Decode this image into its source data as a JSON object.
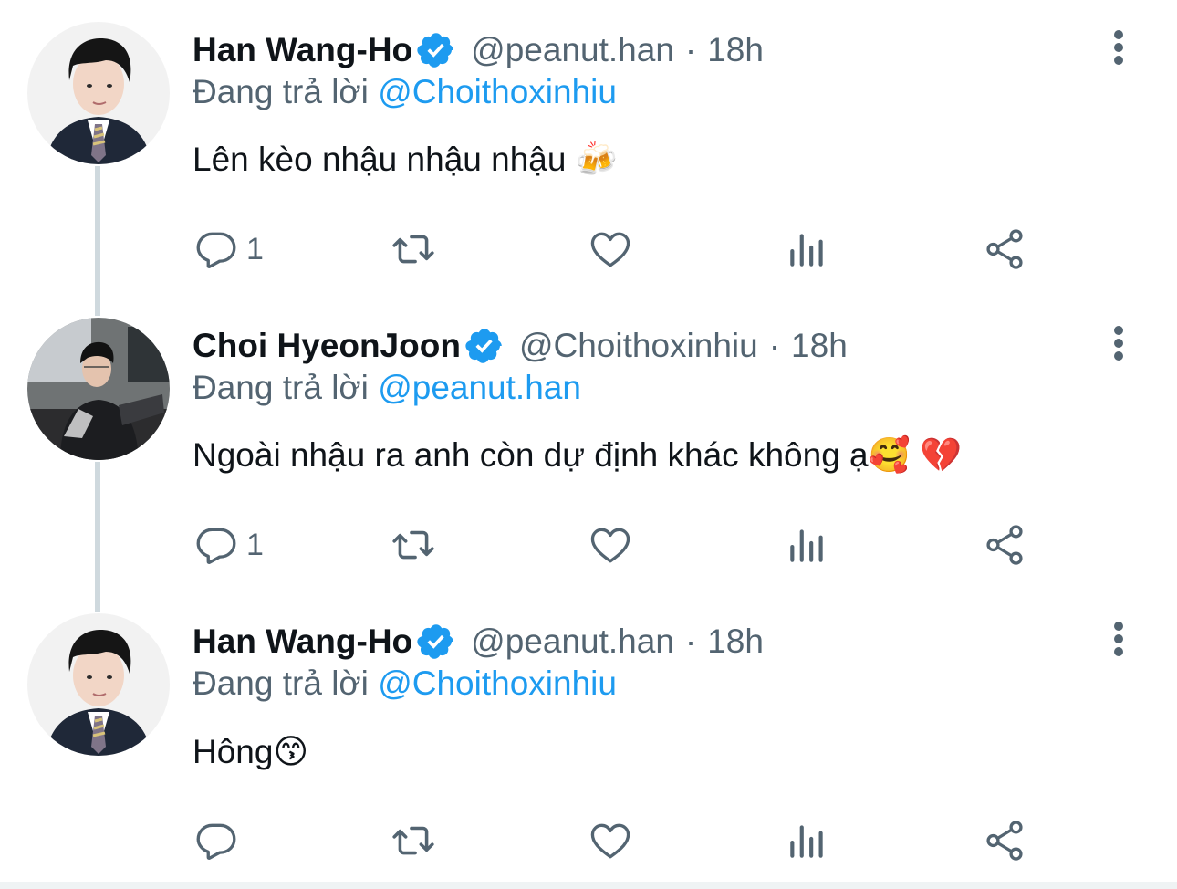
{
  "colors": {
    "accent": "#1d9bf0",
    "text": "#0f1419",
    "secondary": "#536471",
    "thread_line": "#cfd9de"
  },
  "tweets": [
    {
      "name": "Han Wang-Ho",
      "handle": "@peanut.han",
      "separator": "·",
      "time": "18h",
      "replying_prefix": "Đang trả lời",
      "replying_to": "@Choithoxinhiu",
      "text": "Lên kèo nhậu nhậu nhậu 🍻",
      "reply_count": "1",
      "avatar_icon": "avatar-photo"
    },
    {
      "name": "Choi HyeonJoon",
      "handle": "@Choithoxinhiu",
      "separator": "·",
      "time": "18h",
      "replying_prefix": "Đang trả lời",
      "replying_to": "@peanut.han",
      "text": "Ngoài nhậu ra anh còn dự định khác không ạ🥰 💔",
      "reply_count": "1",
      "avatar_icon": "avatar-photo"
    },
    {
      "name": "Han Wang-Ho",
      "handle": "@peanut.han",
      "separator": "·",
      "time": "18h",
      "replying_prefix": "Đang trả lời",
      "replying_to": "@Choithoxinhiu",
      "text": "Hông😙",
      "reply_count": "",
      "avatar_icon": "avatar-photo"
    }
  ],
  "icons": {
    "verified": "verified-badge-icon",
    "more": "more-vertical-icon",
    "reply": "reply-icon",
    "retweet": "retweet-icon",
    "like": "heart-icon",
    "views": "analytics-icon",
    "share": "share-icon"
  }
}
